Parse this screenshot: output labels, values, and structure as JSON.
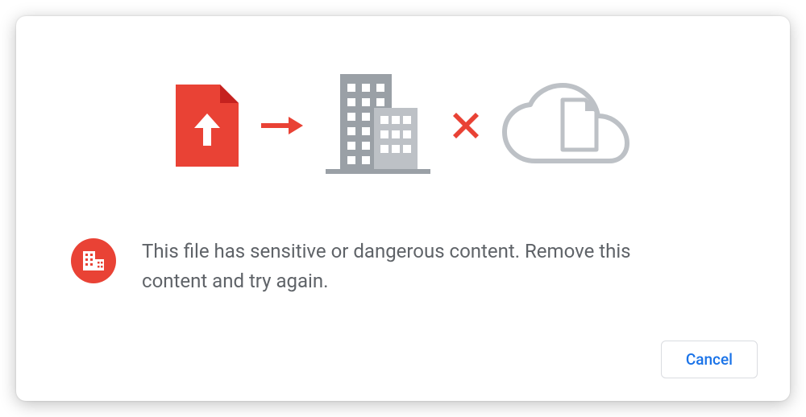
{
  "message": {
    "text": "This file has sensitive or dangerous content. Remove this content and try again."
  },
  "actions": {
    "cancel_label": "Cancel"
  },
  "colors": {
    "danger": "#e94235",
    "text": "#5f6368",
    "accent": "#1a73e8",
    "border": "#dadce0",
    "icon_gray": "#9aa0a6",
    "icon_gray_light": "#bdc1c6"
  }
}
